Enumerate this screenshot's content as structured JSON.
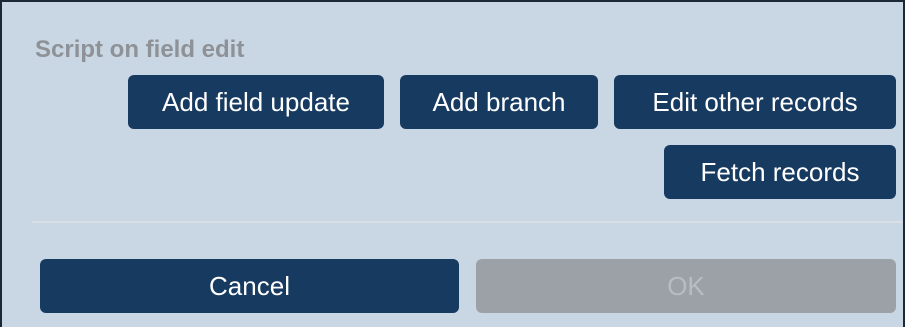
{
  "dialog": {
    "section_title": "Script on field edit",
    "actions": {
      "add_field_update": "Add field update",
      "add_branch": "Add branch",
      "edit_other_records": "Edit other records",
      "fetch_records": "Fetch records"
    },
    "footer": {
      "cancel": "Cancel",
      "ok": "OK",
      "ok_enabled": false
    },
    "colors": {
      "background": "#c9d6e3",
      "button": "#173a60",
      "button_disabled": "#9ba1a7",
      "title_text": "#8e9297"
    }
  }
}
